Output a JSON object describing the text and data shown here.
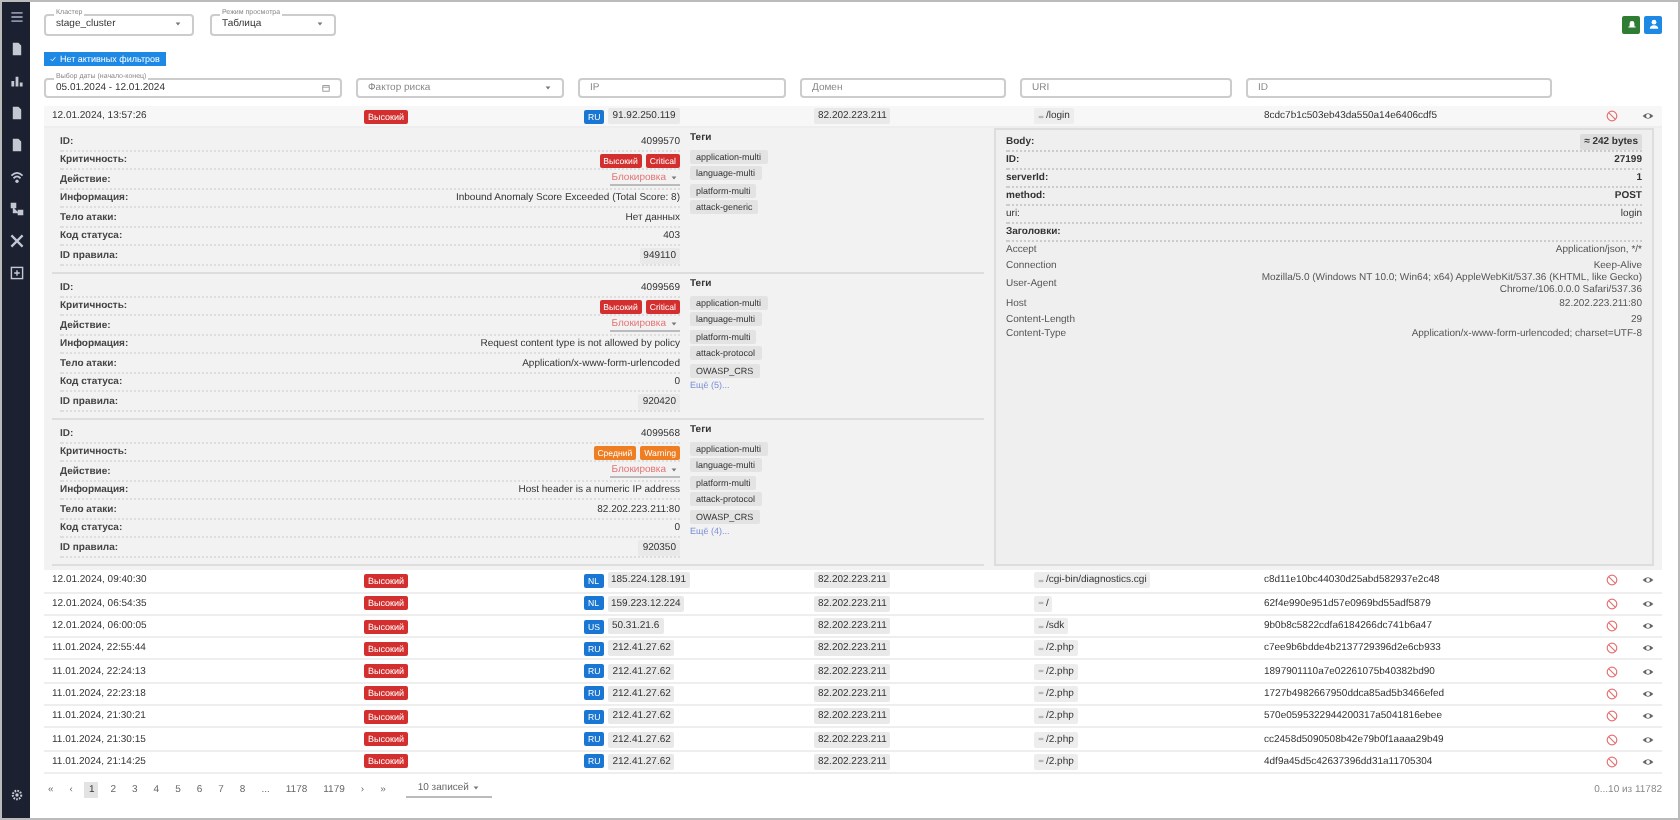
{
  "top": {
    "cluster": {
      "label": "Кластер",
      "value": "stage_cluster"
    },
    "view_mode": {
      "label": "Режим просмотра",
      "value": "Таблица"
    }
  },
  "filter_chip": "Нет активных фильтров",
  "filters": [
    {
      "kind": "date",
      "label": "Выбор даты (начало-конец)",
      "value": "05.01.2024 - 12.01.2024"
    },
    {
      "kind": "select",
      "placeholder": "Фактор риска"
    },
    {
      "kind": "text",
      "placeholder": "IP"
    },
    {
      "kind": "text",
      "placeholder": "Домен"
    },
    {
      "kind": "text",
      "placeholder": "URI"
    },
    {
      "kind": "text",
      "placeholder": "ID"
    }
  ],
  "events": [
    {
      "time": "12.01.2024, 13:57:26",
      "severity": "Высокий",
      "color": "#d32f2f",
      "country": "RU",
      "src_ip": "91.92.250.119",
      "dst_ip": "82.202.223.211",
      "uri": "/login",
      "hash": "8cdc7b1c503eb43da550a14e6406cdf5",
      "expanded": true
    },
    {
      "time": "12.01.2024, 09:40:30",
      "severity": "Высокий",
      "color": "#d32f2f",
      "country": "NL",
      "src_ip": "185.224.128.191",
      "dst_ip": "82.202.223.211",
      "uri": "/cgi-bin/diagnostics.cgi",
      "hash": "c8d11e10bc44030d25abd582937e2c48",
      "expanded": false
    },
    {
      "time": "12.01.2024, 06:54:35",
      "severity": "Высокий",
      "color": "#d32f2f",
      "country": "NL",
      "src_ip": "159.223.12.224",
      "dst_ip": "82.202.223.211",
      "uri": "/",
      "hash": "62f4e990e951d57e0969bd55adf5879",
      "expanded": false
    },
    {
      "time": "12.01.2024, 06:00:05",
      "severity": "Высокий",
      "color": "#d32f2f",
      "country": "US",
      "src_ip": "50.31.21.6",
      "dst_ip": "82.202.223.211",
      "uri": "/sdk",
      "hash": "9b0b8c5822cdfa6184266dc741b6a47",
      "expanded": false
    },
    {
      "time": "11.01.2024, 22:55:44",
      "severity": "Высокий",
      "color": "#d32f2f",
      "country": "RU",
      "src_ip": "212.41.27.62",
      "dst_ip": "82.202.223.211",
      "uri": "/2.php",
      "hash": "c7ee9b6bdde4b2137729396d2e6cb933",
      "expanded": false
    },
    {
      "time": "11.01.2024, 22:24:13",
      "severity": "Высокий",
      "color": "#d32f2f",
      "country": "RU",
      "src_ip": "212.41.27.62",
      "dst_ip": "82.202.223.211",
      "uri": "/2.php",
      "hash": "1897901110a7e02261075b40382bd90",
      "expanded": false
    },
    {
      "time": "11.01.2024, 22:23:18",
      "severity": "Высокий",
      "color": "#d32f2f",
      "country": "RU",
      "src_ip": "212.41.27.62",
      "dst_ip": "82.202.223.211",
      "uri": "/2.php",
      "hash": "1727b4982667950ddca85ad5b3466efed",
      "expanded": false
    },
    {
      "time": "11.01.2024, 21:30:21",
      "severity": "Высокий",
      "color": "#d32f2f",
      "country": "RU",
      "src_ip": "212.41.27.62",
      "dst_ip": "82.202.223.211",
      "uri": "/2.php",
      "hash": "570e0595322944200317a5041816ebee",
      "expanded": false
    },
    {
      "time": "11.01.2024, 21:30:15",
      "severity": "Высокий",
      "color": "#d32f2f",
      "country": "RU",
      "src_ip": "212.41.27.62",
      "dst_ip": "82.202.223.211",
      "uri": "/2.php",
      "hash": "cc2458d5090508b42e79b0f1aaaa29b49",
      "expanded": false
    },
    {
      "time": "11.01.2024, 21:14:25",
      "severity": "Высокий",
      "color": "#d32f2f",
      "country": "RU",
      "src_ip": "212.41.27.62",
      "dst_ip": "82.202.223.211",
      "uri": "/2.php",
      "hash": "4df9a45d5c42637396dd31a11705304",
      "expanded": false
    }
  ],
  "details": {
    "rules": [
      {
        "fields": [
          {
            "kind": "text",
            "label": "ID:",
            "value": "4099570"
          },
          {
            "kind": "badges",
            "label": "Критичность:",
            "badges": [
              {
                "text": "Высокий",
                "color": "#d32f2f"
              },
              {
                "text": "Critical",
                "color": "#d32f2f"
              }
            ]
          },
          {
            "kind": "select",
            "label": "Действие:",
            "value": "Блокировка"
          },
          {
            "kind": "text",
            "label": "Информация:",
            "value": "Inbound Anomaly Score Exceeded (Total Score: 8)"
          },
          {
            "kind": "text",
            "label": "Тело атаки:",
            "value": "Нет данных"
          },
          {
            "kind": "text",
            "label": "Код статуса:",
            "value": "403"
          },
          {
            "kind": "chip",
            "label": "ID правила:",
            "value": "949110"
          }
        ],
        "tags_title": "Теги",
        "tags": [
          "application-multi",
          "language-multi",
          "platform-multi",
          "attack-generic"
        ]
      },
      {
        "fields": [
          {
            "kind": "text",
            "label": "ID:",
            "value": "4099569"
          },
          {
            "kind": "badges",
            "label": "Критичность:",
            "badges": [
              {
                "text": "Высокий",
                "color": "#d32f2f"
              },
              {
                "text": "Critical",
                "color": "#d32f2f"
              }
            ]
          },
          {
            "kind": "select",
            "label": "Действие:",
            "value": "Блокировка"
          },
          {
            "kind": "text",
            "label": "Информация:",
            "value": "Request content type is not allowed by policy"
          },
          {
            "kind": "text",
            "label": "Тело атаки:",
            "value": "Application/x-www-form-urlencoded"
          },
          {
            "kind": "text",
            "label": "Код статуса:",
            "value": "0"
          },
          {
            "kind": "chip",
            "label": "ID правила:",
            "value": "920420"
          }
        ],
        "tags_title": "Теги",
        "tags": [
          "application-multi",
          "language-multi",
          "platform-multi",
          "attack-protocol",
          "OWASP_CRS"
        ],
        "more": "Ещё (5)..."
      },
      {
        "fields": [
          {
            "kind": "text",
            "label": "ID:",
            "value": "4099568"
          },
          {
            "kind": "badges",
            "label": "Критичность:",
            "badges": [
              {
                "text": "Средний",
                "color": "#ef7d22"
              },
              {
                "text": "Warning",
                "color": "#ef7d22"
              }
            ]
          },
          {
            "kind": "select",
            "label": "Действие:",
            "value": "Блокировка"
          },
          {
            "kind": "text",
            "label": "Информация:",
            "value": "Host header is a numeric IP address"
          },
          {
            "kind": "text",
            "label": "Тело атаки:",
            "value": "82.202.223.211:80"
          },
          {
            "kind": "text",
            "label": "Код статуса:",
            "value": "0"
          },
          {
            "kind": "chip",
            "label": "ID правила:",
            "value": "920350"
          }
        ],
        "tags_title": "Теги",
        "tags": [
          "application-multi",
          "language-multi",
          "platform-multi",
          "attack-protocol",
          "OWASP_CRS"
        ],
        "more": "Ещё (4)..."
      }
    ],
    "request": {
      "body_label": "Body:",
      "body_size": "≈ 242 bytes",
      "fields": [
        {
          "label": "ID:",
          "value": "27199",
          "strong": true
        },
        {
          "label": "serverId:",
          "value": "1",
          "strong": true
        },
        {
          "label": "method:",
          "value": "POST",
          "strong": true
        },
        {
          "label": "uri:",
          "value": "login",
          "strong": false
        }
      ],
      "headers_title": "Заголовки:",
      "headers": [
        {
          "name": "Accept",
          "value": "Application/json, */*"
        },
        {
          "name": "Connection",
          "value": "Keep-Alive"
        },
        {
          "name": "User-Agent",
          "value": "Mozilla/5.0 (Windows NT 10.0; Win64; x64) AppleWebKit/537.36 (KHTML, like Gecko) Chrome/106.0.0.0 Safari/537.36"
        },
        {
          "name": "Host",
          "value": "82.202.223.211:80"
        },
        {
          "name": "Content-Length",
          "value": "29"
        },
        {
          "name": "Content-Type",
          "value": "Application/x-www-form-urlencoded; charset=UTF-8"
        }
      ]
    }
  },
  "pagination": {
    "first": "«",
    "prev": "‹",
    "pages": [
      {
        "label": "1",
        "selected": true
      },
      {
        "label": "2",
        "selected": false
      },
      {
        "label": "3",
        "selected": false
      },
      {
        "label": "4",
        "selected": false
      },
      {
        "label": "5",
        "selected": false
      },
      {
        "label": "6",
        "selected": false
      },
      {
        "label": "7",
        "selected": false
      },
      {
        "label": "8",
        "selected": false
      },
      {
        "label": "...",
        "selected": false
      },
      {
        "label": "1178",
        "selected": false
      },
      {
        "label": "1179",
        "selected": false
      }
    ],
    "next": "›",
    "last": "»",
    "page_size": "10 записей",
    "summary": "0...10 из 11782"
  }
}
